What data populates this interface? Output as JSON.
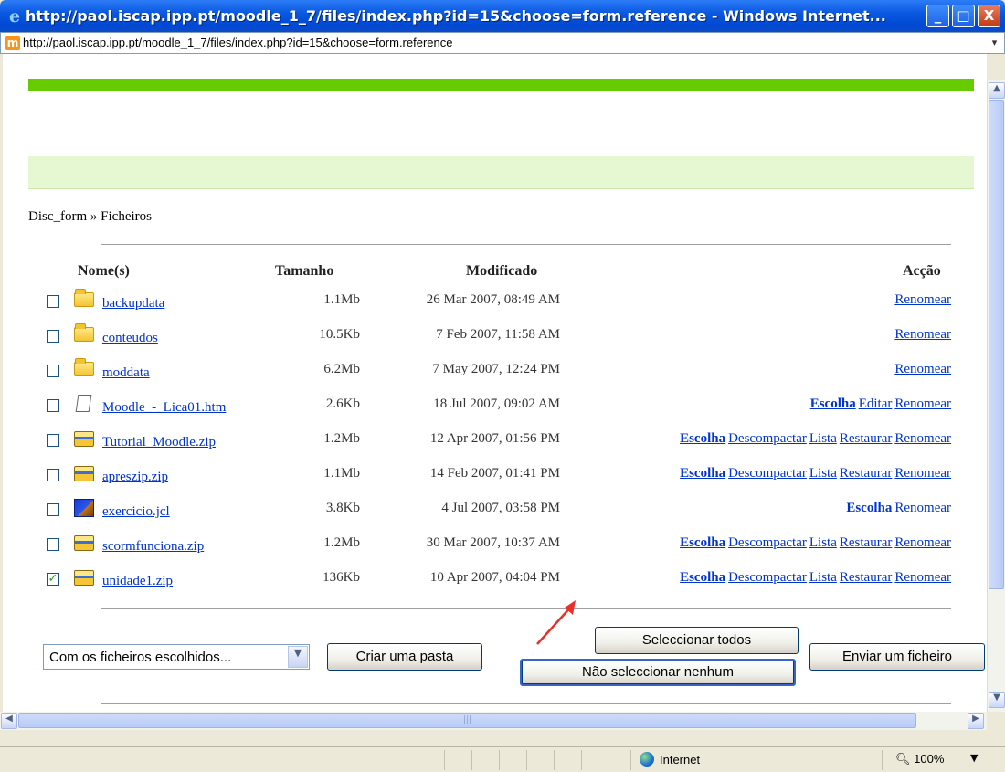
{
  "window": {
    "title": "http://paol.iscap.ipp.pt/moodle_1_7/files/index.php?id=15&choose=form.reference - Windows Internet...",
    "min_glyph": "_",
    "max_glyph": "□",
    "close_glyph": "X"
  },
  "address": {
    "favicon": "m",
    "url": "http://paol.iscap.ipp.pt/moodle_1_7/files/index.php?id=15&choose=form.reference"
  },
  "page": {
    "breadcrumb": "Disc_form » Ficheiros",
    "headers": {
      "name": "Nome(s)",
      "size": "Tamanho",
      "modified": "Modificado",
      "action": "Acção"
    },
    "files": [
      {
        "name": "backupdata",
        "icon": "folder-icon",
        "size": "1.1Mb",
        "modified": "26 Mar 2007, 08:49 AM",
        "checked": false,
        "actions": [
          {
            "label": "Renomear",
            "bold": false
          }
        ]
      },
      {
        "name": "conteudos",
        "icon": "folder-icon",
        "size": "10.5Kb",
        "modified": "7 Feb 2007, 11:58 AM",
        "checked": false,
        "actions": [
          {
            "label": "Renomear",
            "bold": false
          }
        ]
      },
      {
        "name": "moddata",
        "icon": "folder-icon",
        "size": "6.2Mb",
        "modified": "7 May 2007, 12:24 PM",
        "checked": false,
        "actions": [
          {
            "label": "Renomear",
            "bold": false
          }
        ]
      },
      {
        "name": "Moodle_-_Lica01.htm",
        "icon": "html-file-icon",
        "size": "2.6Kb",
        "modified": "18 Jul 2007, 09:02 AM",
        "checked": false,
        "actions": [
          {
            "label": "Escolha",
            "bold": true
          },
          {
            "label": "Editar",
            "bold": false
          },
          {
            "label": "Renomear",
            "bold": false
          }
        ]
      },
      {
        "name": "Tutorial_Moodle.zip",
        "icon": "zip-file-icon",
        "size": "1.2Mb",
        "modified": "12 Apr 2007, 01:56 PM",
        "checked": false,
        "actions": [
          {
            "label": "Escolha",
            "bold": true
          },
          {
            "label": "Descompactar",
            "bold": false
          },
          {
            "label": "Lista",
            "bold": false
          },
          {
            "label": "Restaurar",
            "bold": false
          },
          {
            "label": "Renomear",
            "bold": false
          }
        ]
      },
      {
        "name": "apreszip.zip",
        "icon": "zip-file-icon",
        "size": "1.1Mb",
        "modified": "14 Feb 2007, 01:41 PM",
        "checked": false,
        "actions": [
          {
            "label": "Escolha",
            "bold": true
          },
          {
            "label": "Descompactar",
            "bold": false
          },
          {
            "label": "Lista",
            "bold": false
          },
          {
            "label": "Restaurar",
            "bold": false
          },
          {
            "label": "Renomear",
            "bold": false
          }
        ]
      },
      {
        "name": "exercicio.jcl",
        "icon": "jcl-file-icon",
        "size": "3.8Kb",
        "modified": "4 Jul 2007, 03:58 PM",
        "checked": false,
        "actions": [
          {
            "label": "Escolha",
            "bold": true
          },
          {
            "label": "Renomear",
            "bold": false
          }
        ]
      },
      {
        "name": "scormfunciona.zip",
        "icon": "zip-file-icon",
        "size": "1.2Mb",
        "modified": "30 Mar 2007, 10:37 AM",
        "checked": false,
        "actions": [
          {
            "label": "Escolha",
            "bold": true
          },
          {
            "label": "Descompactar",
            "bold": false
          },
          {
            "label": "Lista",
            "bold": false
          },
          {
            "label": "Restaurar",
            "bold": false
          },
          {
            "label": "Renomear",
            "bold": false
          }
        ]
      },
      {
        "name": "unidade1.zip",
        "icon": "zip-file-icon",
        "size": "136Kb",
        "modified": "10 Apr 2007, 04:04 PM",
        "checked": true,
        "actions": [
          {
            "label": "Escolha",
            "bold": true
          },
          {
            "label": "Descompactar",
            "bold": false
          },
          {
            "label": "Lista",
            "bold": false
          },
          {
            "label": "Restaurar",
            "bold": false
          },
          {
            "label": "Renomear",
            "bold": false
          }
        ]
      }
    ],
    "controls": {
      "with_selected": "Com os ficheiros escolhidos...",
      "create_folder": "Criar uma pasta",
      "select_all": "Seleccionar todos",
      "select_none": "Não seleccionar nenhum",
      "upload": "Enviar um ficheiro"
    }
  },
  "statusbar": {
    "zone": "Internet",
    "zoom": "100%"
  },
  "colors": {
    "link": "#0033cc",
    "moodle_green": "#66cc00",
    "light_green": "#e5f8d2",
    "annotation_arrow": "#e8302b"
  }
}
